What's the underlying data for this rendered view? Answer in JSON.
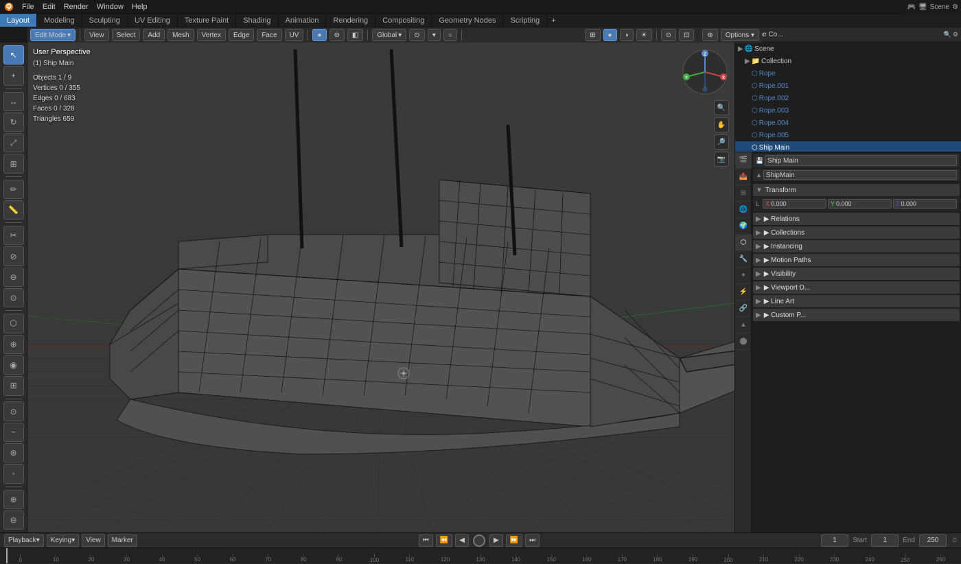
{
  "app": {
    "title": "Blender"
  },
  "top_menu": {
    "items": [
      "Blender",
      "File",
      "Edit",
      "Render",
      "Window",
      "Help"
    ]
  },
  "workspace_tabs": {
    "tabs": [
      "Layout",
      "Modeling",
      "Sculpting",
      "UV Editing",
      "Texture Paint",
      "Shading",
      "Animation",
      "Rendering",
      "Compositing",
      "Geometry Nodes",
      "Scripting"
    ],
    "active": "Layout",
    "add_icon": "+"
  },
  "main_header": {
    "mode": "Edit Mode",
    "view": "View",
    "select": "Select",
    "add": "Add",
    "mesh": "Mesh",
    "vertex": "Vertex",
    "edge": "Edge",
    "face": "Face",
    "uv": "UV",
    "transform": "Global",
    "snap_icon": "⊙",
    "proportional": "○",
    "overlay": "⊙",
    "xray": "⊡",
    "viewport_shading": "●",
    "options": "Options ▾"
  },
  "viewport": {
    "perspective": "User Perspective",
    "active_object": "(1) Ship Main",
    "stats": {
      "objects": "Objects  1 / 9",
      "vertices": "Vertices  0 / 355",
      "edges": "Edges     0 / 683",
      "faces": "Faces     0 / 328",
      "triangles": "Triangles  659"
    }
  },
  "right_panel": {
    "header_tabs": [
      "☰",
      "🔍",
      "📷",
      "🎭",
      "🌍",
      "⚙",
      "🖱",
      "✦",
      "▶",
      "💡",
      "🔧"
    ],
    "scene_name": "Scene",
    "collection_header": "Scene Co...",
    "outliner_items": [
      {
        "name": "Colle...",
        "indent": 0
      },
      {
        "name": "R",
        "indent": 1
      },
      {
        "name": "R",
        "indent": 1
      },
      {
        "name": "R",
        "indent": 1
      },
      {
        "name": "R",
        "indent": 1
      },
      {
        "name": "R",
        "indent": 1
      }
    ],
    "properties": {
      "active_tab": "object",
      "item_name": "Ship M...",
      "item_sub": "Shi...",
      "transform_header": "Transform",
      "location_label": "L",
      "relations_header": "▶ Relations",
      "collections_header": "▶ Collections",
      "instancing_header": "▶ Instancing",
      "motion_paths_header": "▶ Motion Paths",
      "visibility_header": "▶ Visibility",
      "viewport_display_header": "▶ Viewport D...",
      "line_art_header": "▶ Line Art",
      "custom_props_header": "▶ Custom P..."
    }
  },
  "left_toolbar": {
    "tools": [
      {
        "icon": "↖",
        "label": "select",
        "active": true
      },
      {
        "icon": "⊕",
        "label": "cursor"
      },
      {
        "icon": "↔",
        "label": "move"
      },
      {
        "icon": "↻",
        "label": "rotate"
      },
      {
        "icon": "⤢",
        "label": "scale"
      },
      {
        "icon": "⊞",
        "label": "transform"
      },
      {
        "separator": true
      },
      {
        "icon": "✏",
        "label": "annotate"
      },
      {
        "separator": true
      },
      {
        "icon": "⬜",
        "label": "box-select"
      },
      {
        "icon": "▣",
        "label": "lasso"
      },
      {
        "separator": true
      },
      {
        "icon": "✂",
        "label": "knife"
      },
      {
        "icon": "⊖",
        "label": "loop-cut"
      },
      {
        "icon": "◎",
        "label": "offset-edge"
      },
      {
        "icon": "⊗",
        "label": "slide"
      },
      {
        "icon": "⊞",
        "label": "inset"
      },
      {
        "icon": "⬡",
        "label": "extrude"
      },
      {
        "icon": "⊕",
        "label": "bevel"
      },
      {
        "icon": "⊖",
        "label": "bridge"
      },
      {
        "separator": true
      },
      {
        "icon": "⊙",
        "label": "spin"
      },
      {
        "icon": "~",
        "label": "smooth"
      },
      {
        "icon": "⊘",
        "label": "randomize"
      },
      {
        "icon": "⊞",
        "label": "edge-slide"
      },
      {
        "separator": true
      },
      {
        "icon": "⊛",
        "label": "shrink"
      },
      {
        "icon": "⊕",
        "label": "push-pull"
      },
      {
        "icon": "⬡",
        "label": "sphere"
      }
    ]
  },
  "timeline": {
    "playback_label": "Playback",
    "keying_label": "Keying",
    "view_label": "View",
    "marker_label": "Marker",
    "transport_controls": [
      "⏮",
      "⏪",
      "◀",
      "⏸",
      "▶",
      "⏩",
      "⏭"
    ],
    "frame_current": "1",
    "frame_start_label": "Start",
    "frame_start": "1",
    "frame_end_label": "End",
    "frame_end": "250",
    "ruler_marks": [
      "0",
      "10",
      "20",
      "30",
      "40",
      "50",
      "60",
      "70",
      "80",
      "90",
      "100",
      "110",
      "120",
      "130",
      "140",
      "150",
      "160",
      "170",
      "180",
      "190",
      "200",
      "210",
      "220",
      "230",
      "240",
      "250",
      "260"
    ]
  },
  "colors": {
    "active_tab_bg": "#3d7ab5",
    "toolbar_bg": "#2b2b2b",
    "viewport_bg": "#393939",
    "panel_bg": "#1e1e1e",
    "grid_line": "#333333",
    "axis_x": "#aa3333",
    "axis_y": "#33aa33",
    "ship_wire": "#222222",
    "ship_fill": "#555555",
    "header_bg": "#2b2b2b"
  }
}
